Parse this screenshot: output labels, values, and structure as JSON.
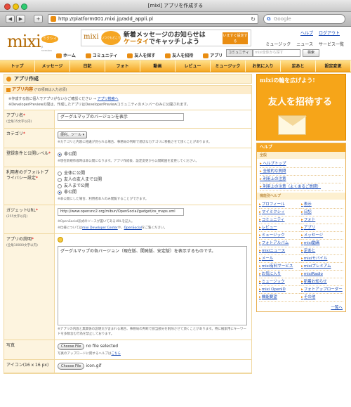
{
  "window": {
    "title": "[mixi] アプリを作成する"
  },
  "browser": {
    "url": "http://platform001.mixi.jp/add_appli.pl",
    "search_placeholder": "Google",
    "back": "◀",
    "forward": "▶",
    "add": "+",
    "reload": "↻"
  },
  "header": {
    "logo": "mixi",
    "logo_badge": "ミクシィ",
    "logo_sub": "β version",
    "banner": {
      "logo": "mixi",
      "circle": "いつでもどこでも",
      "line1": "新着メッセージのお知らせは",
      "line2_k": "ケータイ",
      "line2_rest": "でキャッチしよう",
      "button": "いますぐ設定する"
    },
    "top_links": [
      "ヘルプ",
      "ログアウト"
    ],
    "sub_links": [
      "ミュージック",
      "ニュース",
      "サービス一覧"
    ],
    "main_nav": [
      "ホーム",
      "コミュニティ",
      "友人を探す",
      "友人を招待",
      "アプリ"
    ],
    "search": {
      "select": "コミュニティ",
      "placeholder": "mixi全体から探す",
      "button": "検索"
    }
  },
  "global_nav": [
    "トップ",
    "メッセージ",
    "日記",
    "フォト",
    "動画",
    "レビュー",
    "ミュージック",
    "お気に入り",
    "足あと",
    "設定変更"
  ],
  "form": {
    "title": "アプリ作成",
    "section_title": "アプリ内容",
    "section_req": "(*の項目は入力必須)",
    "notes": [
      "※作成する前に個人でアプリがないかご確認ください →",
      "アプリ検索へ",
      "※DeveloperPreviewの間は、作成したアプリはDeveloperPreviewコミュニティのメンバーのみに公開されます。"
    ],
    "fields": {
      "name": {
        "label": "アプリ名",
        "sub": "(全角15文字以内)",
        "value": "グーグルマップのバージョンを表示"
      },
      "category": {
        "label": "カテゴリ",
        "value": "便利、ツール",
        "hint": "※カテゴリと内容に相違が見られる場合、事務局の判断で適切なカテゴリに移動させて頂くことがあります。"
      },
      "reg": {
        "label": "登録条件と公開レベル",
        "option": "非公開",
        "hint": "※現在新規作成時は非公開になります。アプリ作成後、設定変更から公開範囲を変更してください。"
      },
      "privacy": {
        "label": "利用者のデフォルトプライバシー設定",
        "options": [
          "全体に公開",
          "友人の友人まで公開",
          "友人まで公開",
          "非公開"
        ],
        "selected": 3,
        "hint": "※非公開にした場合、利用者本人のみ閲覧することができます。"
      },
      "gadget": {
        "label": "ガジェットURL",
        "sub": "(255文字以内)",
        "value": "http://www.opensnc2.org/mibun/OpenSocial/gadget/os_maps.xml",
        "hint1": "※OpenSocial形式のソースが置いてあるURLを記入。",
        "hint2_pre": "※仕様については",
        "hint2_l1": "mixi Developer Center",
        "hint2_mid": "や、",
        "hint2_l2": "OpenSocial",
        "hint2_post": "をご覧ください。"
      },
      "desc": {
        "label": "アプリの説明",
        "sub": "(全角10000文字以内)",
        "value": "グーグルマップの各バージョン（現在版、開発版、安定版）を表示するものです。",
        "hint": "※アプリの内容と無関係の説明文が含まれる場合、事務局の判断で該当部分を削除させて頂くことがあります。特に検索用にキーワードを多数含む行為を禁止しております。"
      },
      "photo": {
        "label": "写真",
        "button": "Choose File",
        "file": "no file selected",
        "hint_pre": "写真のアップロードに関するヘルプは",
        "hint_link": "こちら"
      },
      "icon": {
        "label": "アイコン(16 x 16 px)",
        "button": "Choose File",
        "file": "icon.gif"
      }
    }
  },
  "sidebar": {
    "promo": {
      "line1": "mixiの輪を広げよう!",
      "line2": "友人を招待する"
    },
    "help_title": "ヘルプ",
    "general_title": "全般",
    "general": [
      "ヘルプトップ",
      "全般的な質問",
      "利用上の注意",
      "利用上の注意（よくあるご質問）"
    ],
    "feature_title": "機能別ヘルプ",
    "features": [
      "プロフィール",
      "表示",
      "マイミクシィ",
      "日記",
      "コミュニティ",
      "フォト",
      "レビュー",
      "アプリ",
      "ミュージック",
      "メッセージ",
      "フォトアルバム",
      "mixi動画",
      "mixiニュース",
      "足あと",
      "メール",
      "mixiモバイル",
      "mixi有料サービス",
      "mixiプレミアム",
      "お気に入り",
      "mixiRadio",
      "ミュージック",
      "新着お知らせ",
      "mixi OpenID",
      "フォトアップローダー",
      "機能要望",
      "その他"
    ],
    "more": "一覧へ"
  },
  "colors": {
    "accent": "#f5a623",
    "link": "#1a4bb5",
    "brand": "#b36b07"
  }
}
